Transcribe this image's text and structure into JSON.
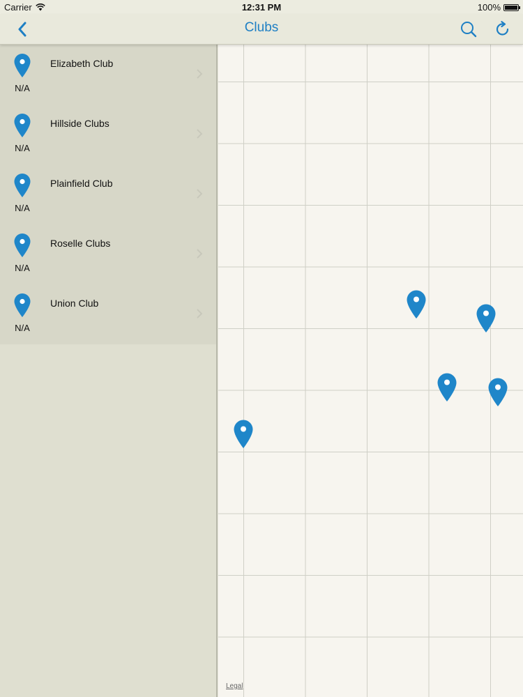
{
  "status_bar": {
    "carrier": "Carrier",
    "time": "12:31 PM",
    "battery": "100%"
  },
  "nav": {
    "title": "Clubs",
    "back_icon": "chevron-left-icon",
    "search_icon": "search-icon",
    "refresh_icon": "refresh-icon"
  },
  "colors": {
    "accent": "#1e7fc4",
    "pin": "#1f86c9"
  },
  "clubs": [
    {
      "name": "Elizabeth Club",
      "distance": "N/A"
    },
    {
      "name": "Hillside Clubs",
      "distance": "N/A"
    },
    {
      "name": "Plainfield Club",
      "distance": "N/A"
    },
    {
      "name": "Roselle Clubs",
      "distance": "N/A"
    },
    {
      "name": "Union Club",
      "distance": "N/A"
    }
  ],
  "map": {
    "legal_label": "Legal"
  }
}
